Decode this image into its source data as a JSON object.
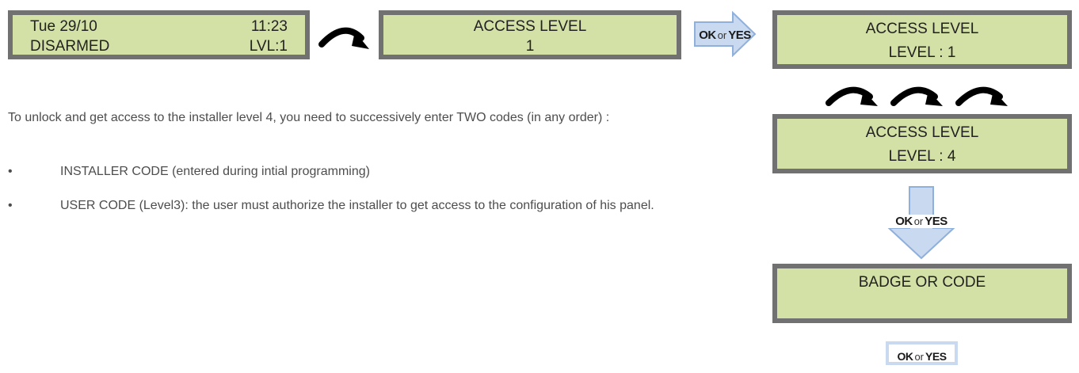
{
  "screen1": {
    "date": "Tue 29/10",
    "time": "11:23",
    "status": "DISARMED",
    "level": "LVL:1"
  },
  "screen2": {
    "title": "ACCESS LEVEL",
    "value": "1"
  },
  "screen3": {
    "title": "ACCESS LEVEL",
    "value": "LEVEL : 1"
  },
  "screen4": {
    "title": "ACCESS LEVEL",
    "value": "LEVEL : 4"
  },
  "screen5": {
    "title": "BADGE OR CODE"
  },
  "confirm": {
    "ok": "OK",
    "or": "or",
    "yes": "YES"
  },
  "text": {
    "intro": "To unlock and get access to the installer level 4, you need to successively enter TWO codes (in any order) :",
    "bullet_symbol": "•",
    "bullets": [
      "INSTALLER CODE (entered during intial programming)",
      "USER CODE (Level3): the user must authorize the installer to get access to the configuration of his panel."
    ]
  },
  "colors": {
    "lcd_background": "#d3e0a6",
    "lcd_border": "#717171",
    "arrow_fill": "#c9d9ef",
    "arrow_stroke": "#8fb0db"
  }
}
